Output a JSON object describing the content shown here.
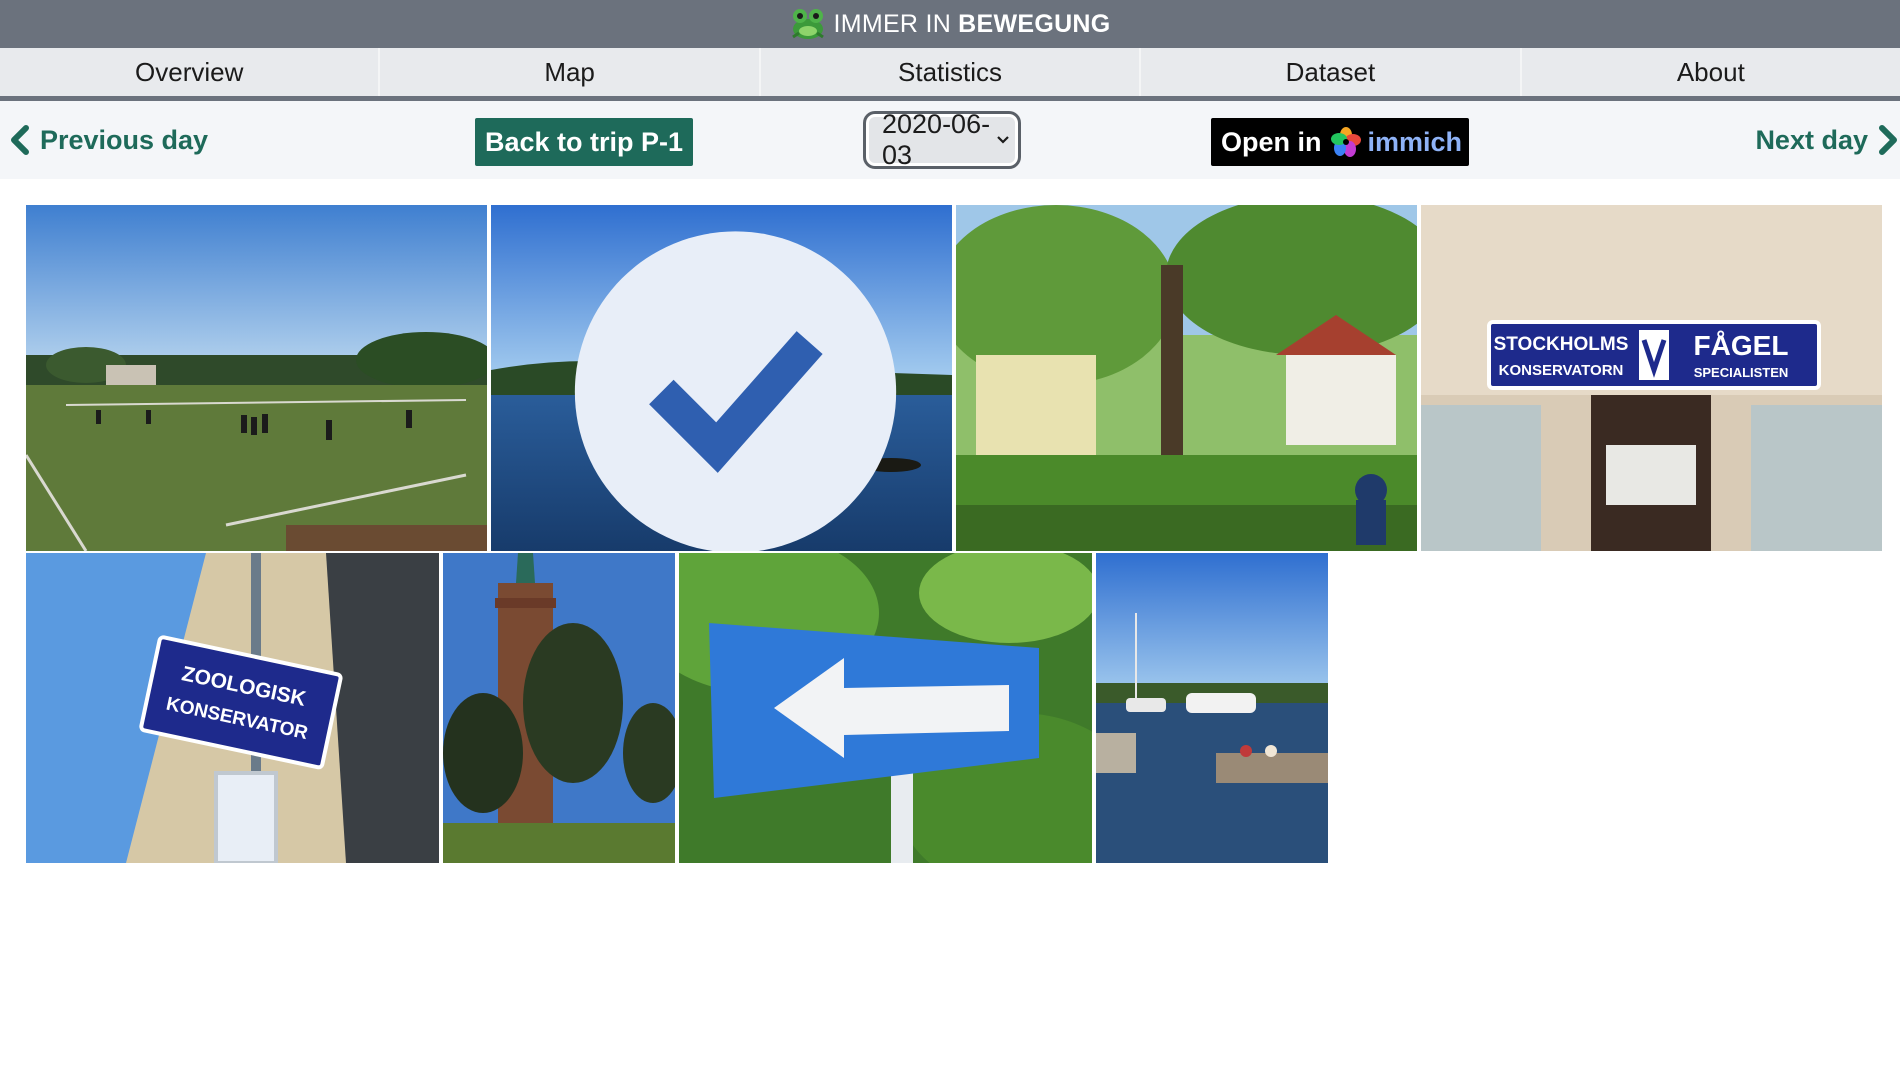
{
  "header": {
    "brand_part1": "IMMER IN",
    "brand_part2": "BEWEGUNG",
    "logo_icon": "frog-icon"
  },
  "nav": {
    "tabs": [
      {
        "label": "Overview"
      },
      {
        "label": "Map"
      },
      {
        "label": "Statistics"
      },
      {
        "label": "Dataset"
      },
      {
        "label": "About"
      }
    ]
  },
  "daybar": {
    "prev_label": "Previous day",
    "next_label": "Next day",
    "back_label": "Back to trip P-1",
    "date_value": "2020-06-03",
    "open_in_label": "Open in",
    "immich_label": "immich"
  },
  "gallery": {
    "photos": [
      {
        "subject": "football pitch with players under clear sky",
        "selected": false
      },
      {
        "subject": "lake with bridge in distance",
        "selected": true
      },
      {
        "subject": "trees and villa garden with cyclist",
        "selected": false
      },
      {
        "subject": "shop sign",
        "selected": false,
        "sign_lines": [
          "STOCKHOLMS",
          "KONSERVATORN",
          "FÅGEL",
          "SPECIALISTEN"
        ]
      },
      {
        "subject": "wall sign",
        "selected": false,
        "sign_lines": [
          "ZOOLOGISK",
          "KONSERVATOR"
        ]
      },
      {
        "subject": "brick tower with pine trees",
        "selected": false
      },
      {
        "subject": "blue one-way arrow sign in foliage",
        "selected": false
      },
      {
        "subject": "marina with boats and jetty",
        "selected": false
      }
    ]
  },
  "colors": {
    "accent_green": "#1e6a5a",
    "header_gray": "#6b727d",
    "immich_blue": "#8fb3f7"
  }
}
